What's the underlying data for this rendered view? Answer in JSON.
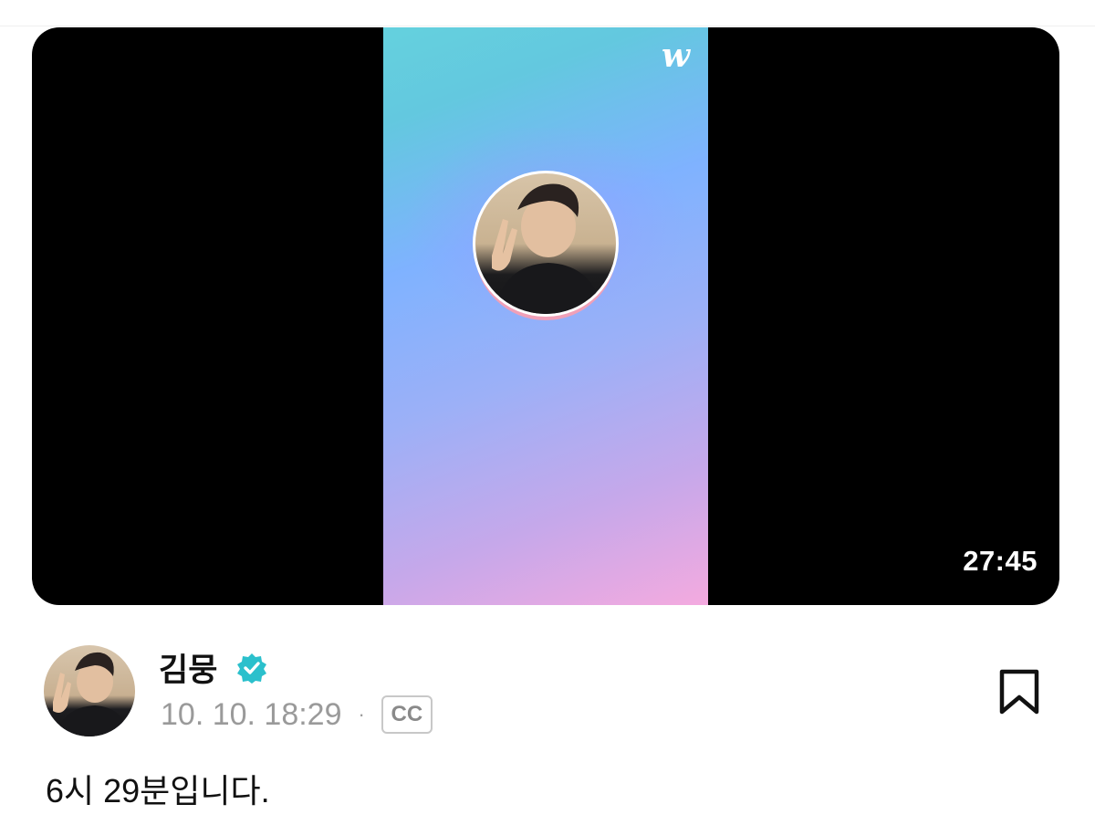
{
  "video": {
    "logo_text": "w",
    "duration": "27:45"
  },
  "author": {
    "name": "김뭉",
    "verified": true
  },
  "post": {
    "date": "10. 10. 18:29",
    "separator": "·",
    "cc_label": "CC",
    "text": "6시 29분입니다."
  },
  "icons": {
    "verified": "verified-badge-icon",
    "bookmark": "bookmark-icon"
  },
  "colors": {
    "verified_badge": "#2bc0cc",
    "gradient_top": "#64d1de",
    "gradient_bottom": "#f4aadf"
  }
}
